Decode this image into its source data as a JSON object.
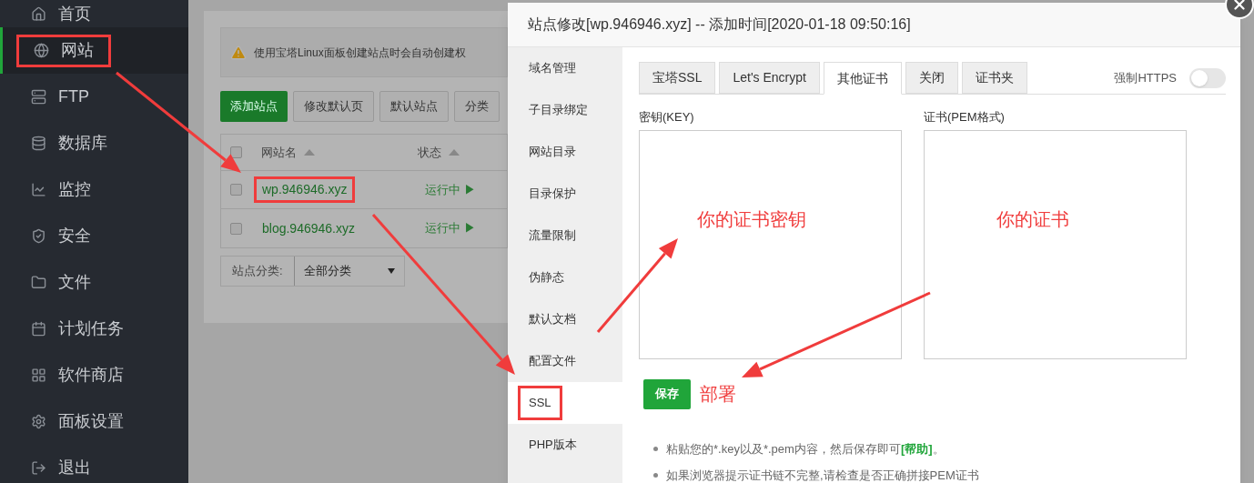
{
  "sidebar": {
    "items": [
      {
        "label": "首页",
        "kind": "home",
        "selected": false,
        "highlighted": false
      },
      {
        "label": "网站",
        "kind": "globe",
        "selected": true,
        "highlighted": true
      },
      {
        "label": "FTP",
        "kind": "server",
        "selected": false,
        "highlighted": false
      },
      {
        "label": "数据库",
        "kind": "database",
        "selected": false,
        "highlighted": false
      },
      {
        "label": "监控",
        "kind": "chart",
        "selected": false,
        "highlighted": false
      },
      {
        "label": "安全",
        "kind": "shield",
        "selected": false,
        "highlighted": false
      },
      {
        "label": "文件",
        "kind": "folder",
        "selected": false,
        "highlighted": false
      },
      {
        "label": "计划任务",
        "kind": "calendar",
        "selected": false,
        "highlighted": false
      },
      {
        "label": "软件商店",
        "kind": "grid",
        "selected": false,
        "highlighted": false
      },
      {
        "label": "面板设置",
        "kind": "gear",
        "selected": false,
        "highlighted": false
      },
      {
        "label": "退出",
        "kind": "logout",
        "selected": false,
        "highlighted": false
      }
    ]
  },
  "main": {
    "notice": "使用宝塔Linux面板创建站点时会自动创建权",
    "buttons": [
      {
        "label": "添加站点",
        "kind": "primary"
      },
      {
        "label": "修改默认页",
        "kind": "default"
      },
      {
        "label": "默认站点",
        "kind": "default"
      },
      {
        "label": "分类",
        "kind": "default"
      }
    ],
    "table": {
      "all_checked": false,
      "columns": [
        "网站名",
        "状态"
      ],
      "rows": [
        {
          "name": "wp.946946.xyz",
          "status": "运行中 ▶",
          "checked": false,
          "highlighted": true
        },
        {
          "name": "blog.946946.xyz",
          "status": "运行中 ▶",
          "checked": false,
          "highlighted": false
        }
      ]
    },
    "filter": {
      "label": "站点分类:",
      "value": "全部分类"
    }
  },
  "dialog": {
    "title": "站点修改[wp.946946.xyz] -- 添加时间[2020-01-18 09:50:16]",
    "menu": [
      {
        "label": "域名管理",
        "selected": false,
        "highlighted": false
      },
      {
        "label": "子目录绑定",
        "selected": false,
        "highlighted": false
      },
      {
        "label": "网站目录",
        "selected": false,
        "highlighted": false
      },
      {
        "label": "目录保护",
        "selected": false,
        "highlighted": false
      },
      {
        "label": "流量限制",
        "selected": false,
        "highlighted": false
      },
      {
        "label": "伪静态",
        "selected": false,
        "highlighted": false
      },
      {
        "label": "默认文档",
        "selected": false,
        "highlighted": false
      },
      {
        "label": "配置文件",
        "selected": false,
        "highlighted": false
      },
      {
        "label": "SSL",
        "selected": true,
        "highlighted": true
      },
      {
        "label": "PHP版本",
        "selected": false,
        "highlighted": false
      }
    ],
    "tabs": [
      {
        "label": "宝塔SSL",
        "selected": false
      },
      {
        "label": "Let's Encrypt",
        "selected": false
      },
      {
        "label": "其他证书",
        "selected": true
      },
      {
        "label": "关闭",
        "selected": false
      },
      {
        "label": "证书夹",
        "selected": false
      }
    ],
    "force_https": {
      "label": "强制HTTPS",
      "on": false
    },
    "key_label": "密钥(KEY)",
    "cert_label": "证书(PEM格式)",
    "save_button": "保存",
    "notes": [
      {
        "text": "粘贴您的*.key以及*.pem内容，然后保存即可",
        "link": "[帮助]",
        "tail": "。"
      },
      {
        "text": "如果浏览器提示证书链不完整,请检查是否正确拼接PEM证书"
      }
    ]
  },
  "annotations": {
    "key_note": "你的证书密钥",
    "cert_note": "你的证书",
    "deploy_note": "部署"
  }
}
